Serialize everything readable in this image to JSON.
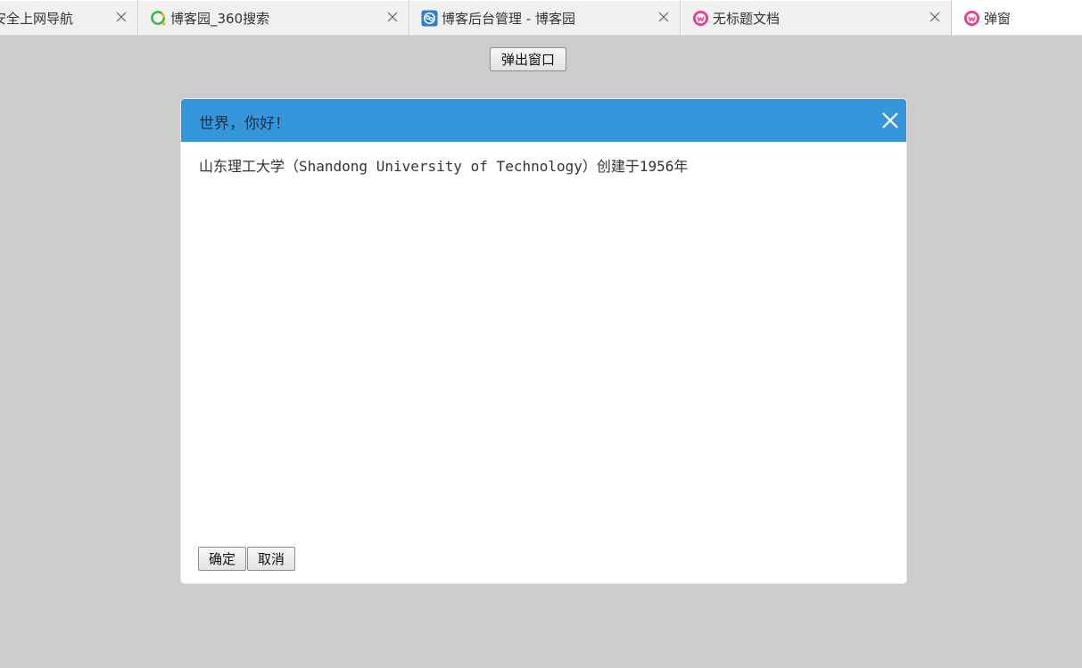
{
  "tabs": [
    {
      "label": "安全上网导航",
      "icon": "none",
      "active": false
    },
    {
      "label": "博客园_360搜索",
      "icon": "360-search-icon",
      "active": false
    },
    {
      "label": "博客后台管理 - 博客园",
      "icon": "cnblogs-icon",
      "active": false
    },
    {
      "label": "无标题文档",
      "icon": "webstorm-icon",
      "active": false
    },
    {
      "label": "弹窗",
      "icon": "webstorm-icon",
      "active": true
    }
  ],
  "page": {
    "open_button_label": "弹出窗口"
  },
  "dialog": {
    "title": "世界，你好！",
    "body": "山东理工大学（Shandong University of Technology）创建于1956年",
    "ok_label": "确定",
    "cancel_label": "取消"
  },
  "colors": {
    "background": "#cccccc",
    "dialog_header": "#3596db",
    "tab_inactive": "#f0f0f0",
    "tab_active": "#ffffff"
  }
}
